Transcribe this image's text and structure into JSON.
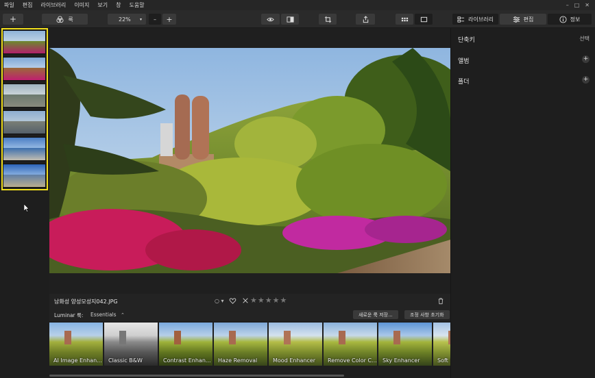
{
  "menubar": {
    "items": [
      "파일",
      "편집",
      "라이브러리",
      "이미지",
      "보기",
      "창",
      "도움말"
    ],
    "window_controls": [
      "–",
      "□",
      "✕"
    ]
  },
  "toolbar": {
    "add_label": "+",
    "looks_label": "룩",
    "zoom_value": "22%",
    "zoom_minus": "–",
    "zoom_plus": "+",
    "library_tab": "라이브러리",
    "edit_tab": "편집",
    "info_tab": "정보"
  },
  "photo": {
    "filename": "남화성 양성모성지042.JPG",
    "rating_stars": 0,
    "flag_label": "○ ▾"
  },
  "looks": {
    "label": "Luminar 룩:",
    "category": "Essentials",
    "save_button": "새로운 룩 저장...",
    "reset_button": "조정 사항 초기화"
  },
  "presets": [
    "AI Image Enhan...",
    "Classic B&W",
    "Contrast Enhan...",
    "Haze Removal",
    "Mood Enhancer",
    "Remove Color C...",
    "Sky Enhancer",
    "Soft & Air"
  ],
  "right_panel": {
    "shortcuts_label": "단축키",
    "select_label": "선택",
    "albums_label": "앨범",
    "folders_label": "폴더"
  },
  "colors": {
    "selection": "#f2e01e",
    "background": "#1e1e1e"
  }
}
